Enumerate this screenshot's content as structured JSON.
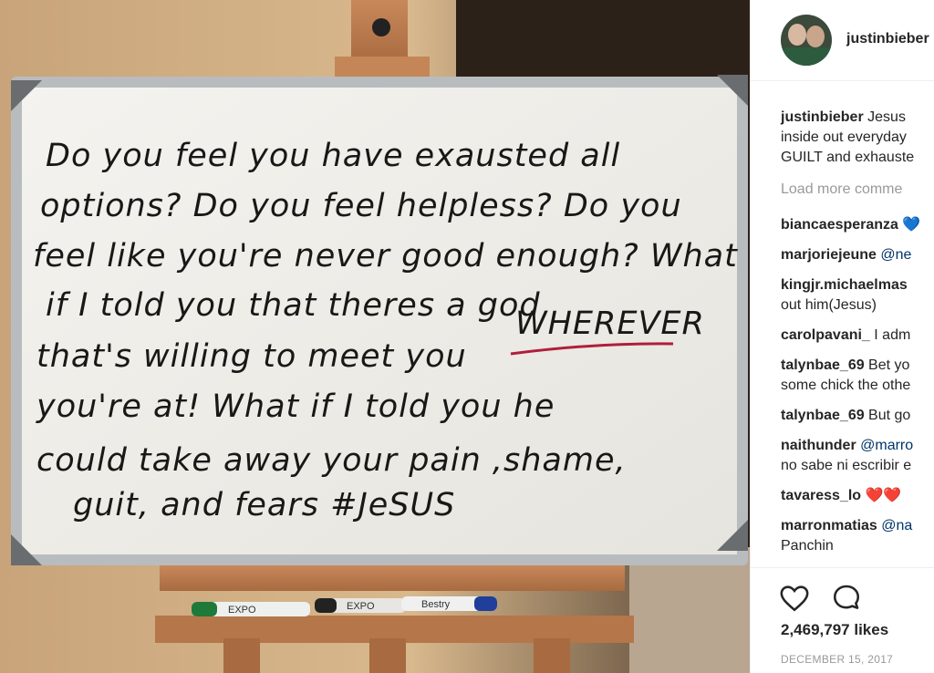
{
  "photo": {
    "board_lines": [
      "Do  you  feel  you  have  exausted  all",
      "options? Do  you  feel  helpless? Do  you",
      "feel  like  you're  never  good  enough? What",
      "if  I  told  you  that  theres  a  god",
      "that's  willing  to  meet  you",
      "you're  at!  What  if  I  told  you  he",
      "could  take  away  your  pain  ,shame,",
      "guit,  and  fears   #JeSUS"
    ],
    "emphasis_word": "WHEREVER",
    "marker_labels": [
      "EXPO",
      "EXPO",
      "Bestry"
    ]
  },
  "post": {
    "username": "justinbieber",
    "caption_user": "justinbieber",
    "caption_lines": [
      "Jesus",
      "inside out everyday",
      "GUILT and exhauste"
    ],
    "load_more": "Load more comme",
    "comments": [
      {
        "user": "biancaesperanza",
        "text": "",
        "mention": " 💙",
        "cont": ""
      },
      {
        "user": "marjoriejeune",
        "text": "",
        "mention": " @ne",
        "cont": ""
      },
      {
        "user": "kingjr.michaelmas",
        "text": "",
        "mention": "",
        "cont": "out him(Jesus)"
      },
      {
        "user": "carolpavani_",
        "text": " I adm",
        "mention": "",
        "cont": ""
      },
      {
        "user": "talynbae_69",
        "text": " Bet yo",
        "mention": "",
        "cont": "some chick the othe"
      },
      {
        "user": "talynbae_69",
        "text": " But go",
        "mention": "",
        "cont": ""
      },
      {
        "user": "naithunder",
        "text": "",
        "mention": " @marro",
        "cont": "no sabe ni escribir e"
      },
      {
        "user": "tavaress_lo",
        "text": " ❤️❤️",
        "mention": "",
        "cont": ""
      },
      {
        "user": "marronmatias",
        "text": "",
        "mention": " @na",
        "cont": "Panchin"
      }
    ],
    "likes": "2,469,797 likes",
    "date": "DECEMBER 15, 2017",
    "icons": {
      "like": "heart-icon",
      "comment": "comment-icon"
    }
  }
}
